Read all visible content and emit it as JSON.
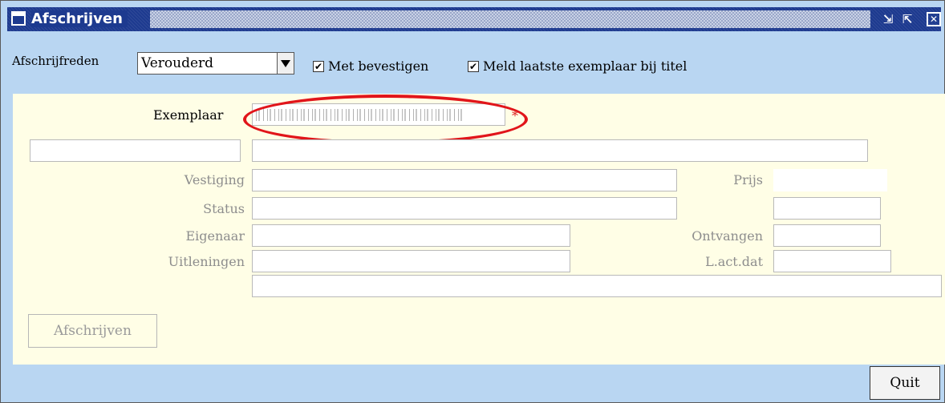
{
  "window": {
    "title": "Afschrijven",
    "controls": [
      "minimize-icon",
      "maximize-icon",
      "close-icon"
    ]
  },
  "options": {
    "reason_label": "Afschrijfreden",
    "reason_value": "Verouderd",
    "confirm_label": "Met bevestigen",
    "confirm_checked": true,
    "report_last_label": "Meld laatste exemplaar bij titel",
    "report_last_checked": true
  },
  "form": {
    "copy_label": "Exemplaar",
    "copy_value": "",
    "required_mark": "*",
    "location_label": "Vestiging",
    "status_label": "Status",
    "owner_label": "Eigenaar",
    "loans_label": "Uitleningen",
    "price_label": "Prijs",
    "received_label": "Ontvangen",
    "last_action_label": "L.act.dat"
  },
  "buttons": {
    "write_off": "Afschrijven",
    "quit": "Quit"
  },
  "colors": {
    "title_bar": "#1d3a8f",
    "panel_bg": "#fffee6",
    "bar_bg": "#b9d6f2",
    "highlight_ring": "#e1151a"
  }
}
